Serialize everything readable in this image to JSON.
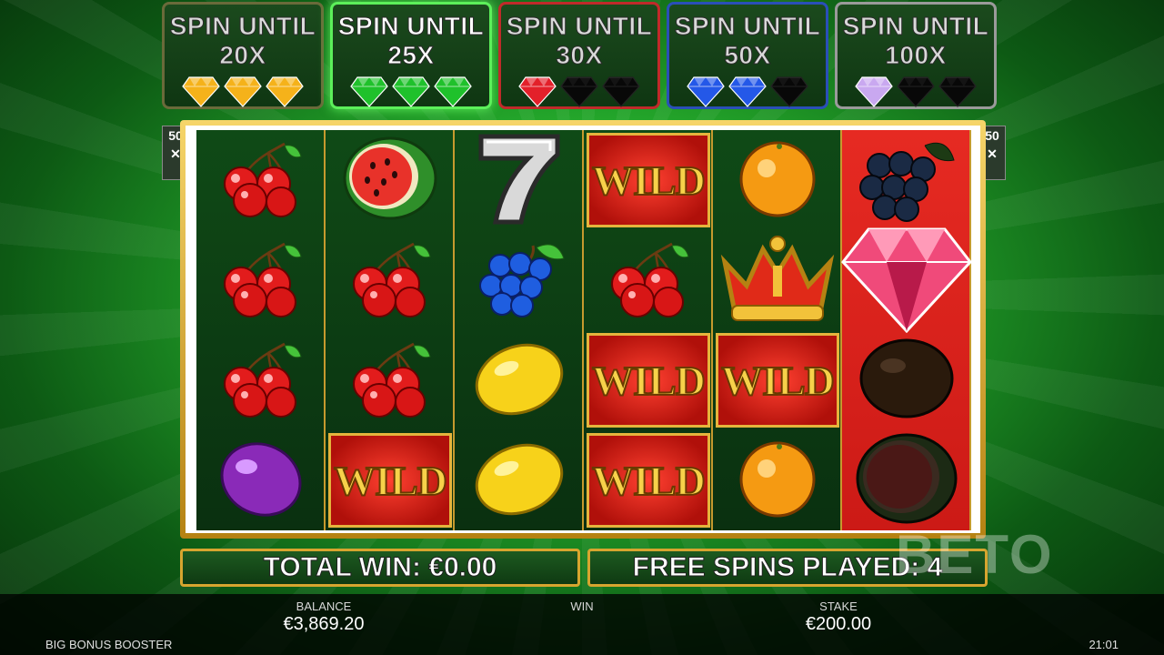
{
  "multipliers": [
    {
      "line1": "SPIN UNTIL",
      "line2": "20X",
      "gems_lit": 3,
      "gem_color": "#f5b21a",
      "border": "#6a6a3a",
      "text_color": "#d9d9d9",
      "active": false
    },
    {
      "line1": "SPIN UNTIL",
      "line2": "25X",
      "gems_lit": 3,
      "gem_color": "#1fc12b",
      "border": "#5cf05a",
      "text_color": "#ffffff",
      "active": true
    },
    {
      "line1": "SPIN UNTIL",
      "line2": "30X",
      "gems_lit": 1,
      "gem_color": "#e3202a",
      "border": "#c02a2a",
      "text_color": "#d9d9d9",
      "active": false
    },
    {
      "line1": "SPIN UNTIL",
      "line2": "50X",
      "gems_lit": 2,
      "gem_color": "#2458e8",
      "border": "#2a4fb8",
      "text_color": "#d9d9d9",
      "active": false
    },
    {
      "line1": "SPIN UNTIL",
      "line2": "100X",
      "gems_lit": 1,
      "gem_color": "#c9a8f0",
      "border": "#9a9a9a",
      "text_color": "#d9d9d9",
      "active": false
    }
  ],
  "side_badges": {
    "left": "50",
    "right": "50"
  },
  "reels": [
    [
      "cherry",
      "cherry",
      "cherry",
      "plum"
    ],
    [
      "watermelon",
      "cherry",
      "cherry",
      "wild"
    ],
    [
      "seven",
      "grapes",
      "lemon",
      "lemon"
    ],
    [
      "wild",
      "cherry",
      "wild",
      "wild"
    ],
    [
      "orange",
      "crown",
      "wild",
      "orange"
    ],
    [
      "grapes-dark",
      "diamond",
      "plum-dark",
      "watermelon-dark"
    ]
  ],
  "red_reel_index": 5,
  "wild_label": "WILD",
  "total_win": "TOTAL WIN: €0.00",
  "free_spins": "FREE SPINS PLAYED: 4",
  "watermark": "BETO",
  "bottom": {
    "balance_label": "BALANCE",
    "balance_value": "€3,869.20",
    "win_label": "WIN",
    "stake_label": "STAKE",
    "stake_value": "€200.00",
    "game_name": "BIG BONUS BOOSTER",
    "time": "21:01"
  }
}
